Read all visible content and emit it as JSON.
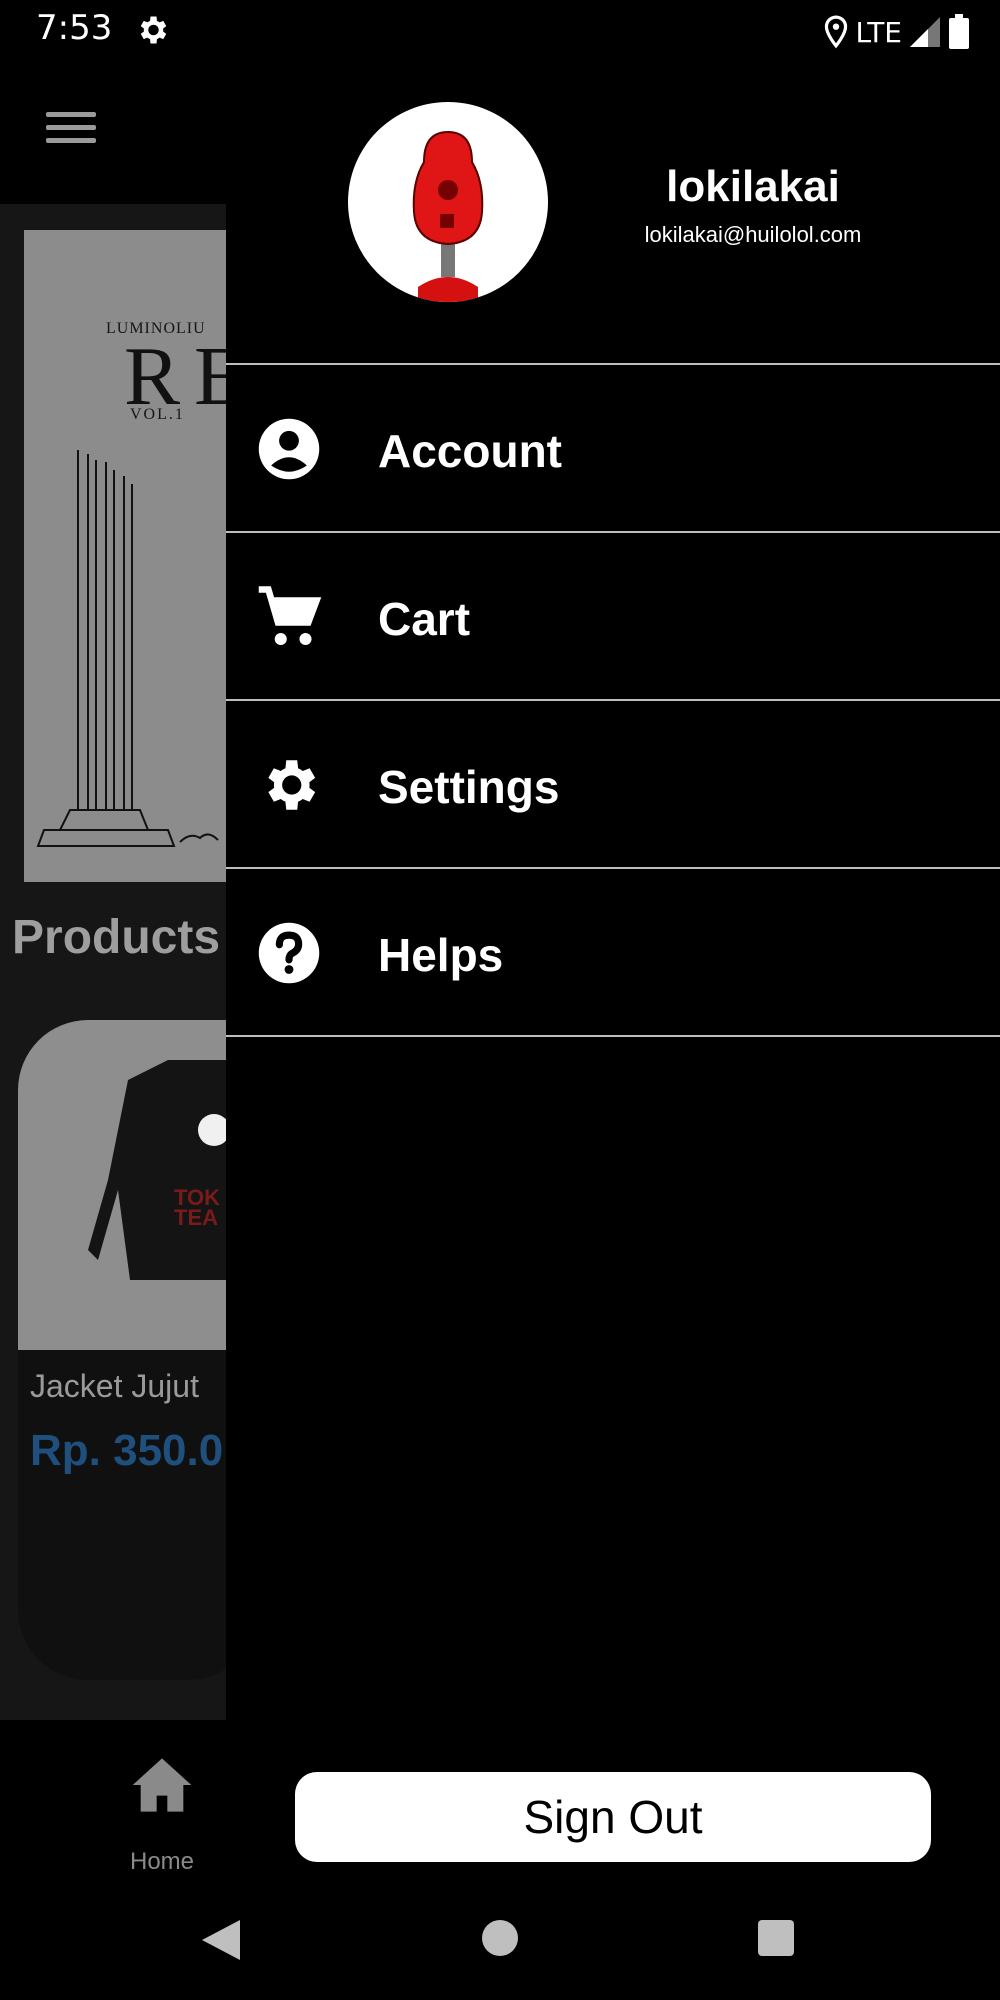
{
  "status_bar": {
    "time": "7:53",
    "network": "LTE"
  },
  "background": {
    "banner": {
      "series": "LUMINOLIU",
      "title": "RE",
      "volume": "VOL.1"
    },
    "section_title": "Products",
    "product": {
      "name": "Jacket Jujut",
      "price": "Rp. 350.0",
      "image_text": "TOK TEAI"
    },
    "bottom_nav": {
      "home_label": "Home"
    }
  },
  "drawer": {
    "user": {
      "name": "lokilakai",
      "email": "lokilakai@huilolol.com"
    },
    "menu": [
      {
        "label": "Account",
        "icon": "account-circle-icon"
      },
      {
        "label": "Cart",
        "icon": "cart-icon"
      },
      {
        "label": "Settings",
        "icon": "gear-icon"
      },
      {
        "label": "Helps",
        "icon": "help-circle-icon"
      }
    ],
    "sign_out_label": "Sign Out"
  },
  "colors": {
    "drawer_bg": "#000000",
    "price": "#1f4f7c",
    "divider": "#bdbdbd"
  }
}
